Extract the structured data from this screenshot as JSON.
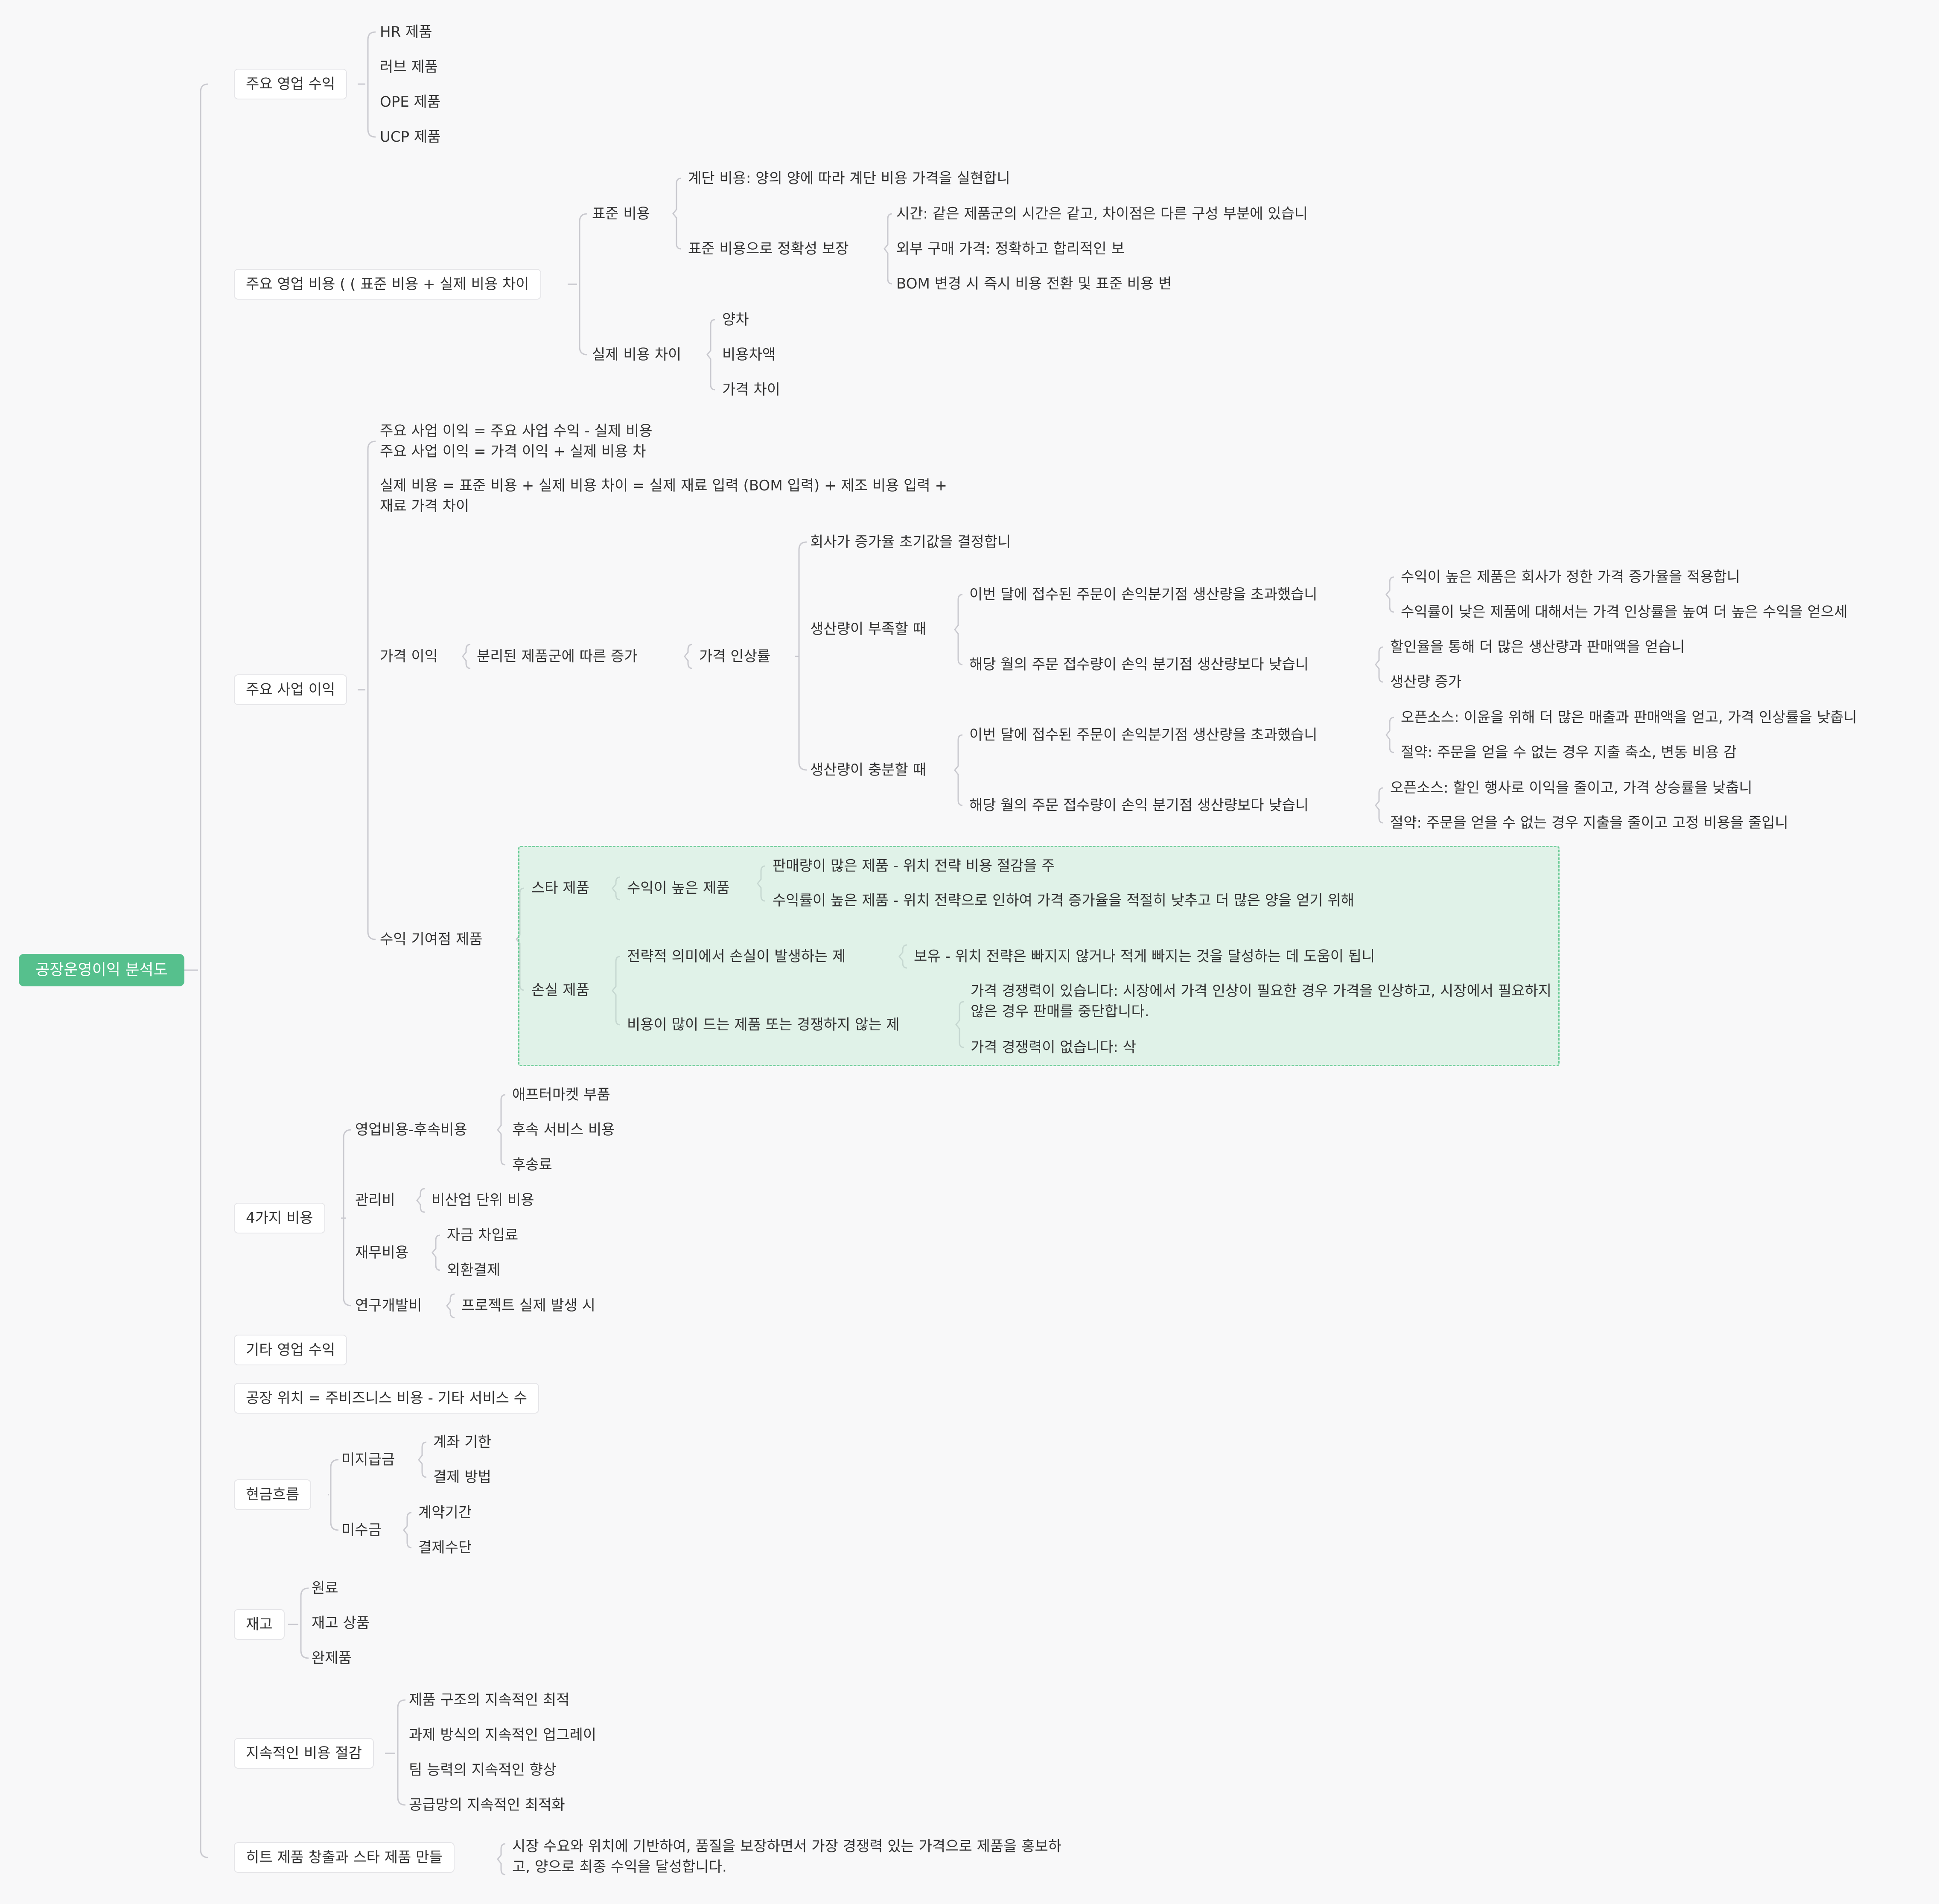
{
  "root": "공장운영이익 분석도",
  "l1": {
    "revenue": "주요 영업 수익",
    "cost": "주요 영업 비용 ( ( 표준 비용 + 실제 비용 차이",
    "profit": "주요 사업 이익",
    "four_costs": "4가지 비용",
    "other_rev": "기타 영업 수익",
    "factory_pos": "공장 위치 = 주비즈니스 비용 - 기타 서비스 수",
    "cashflow": "현금흐름",
    "inventory": "재고",
    "cost_reduction": "지속적인 비용 절감",
    "hit": "히트 제품 창출과 스타 제품 만들"
  },
  "revenue": {
    "items": [
      "HR 제품",
      "러브 제품",
      "OPE 제품",
      "UCP 제품"
    ]
  },
  "cost": {
    "std": "표준 비용",
    "std_step": "계단 비용: 양의 양에 따라 계단 비용 가격을 실현합니",
    "std_ensure": "표준 비용으로 정확성 보장",
    "ensure_items": [
      "시간: 같은 제품군의 시간은 같고, 차이점은 다른 구성 부분에 있습니",
      "외부 구매 가격: 정확하고 합리적인 보",
      "BOM 변경 시 즉시 비용 전환 및 표준 비용 변"
    ],
    "actual": "실제 비용 차이",
    "actual_items": [
      "양차",
      "비용차액",
      "가격 차이"
    ]
  },
  "profit": {
    "formula1": "주요 사업 이익 = 주요 사업 수익 - 실제 비용",
    "formula2": "주요 사업 이익 = 가격 이익 + 실제 비용 차",
    "formula3": "실제 비용 = 표준 비용 + 실제 비용 차이 = 실제 재료 입력 (BOM 입력) + 제조 비용 입력 + 재료 가격 차이",
    "price_profit": "가격 이익",
    "by_group": "분리된 제품군에 따른 증가",
    "rate": "가격 인상률",
    "rate_init": "회사가 증가율 초기값을 결정합니",
    "shortage": "생산량이 부족할 때",
    "short_over": "이번 달에 접수된 주문이 손익분기점 생산량을 초과했습니",
    "short_over_items": [
      "수익이 높은 제품은 회사가 정한 가격 증가율을 적용합니",
      "수익률이 낮은 제품에 대해서는 가격 인상률을 높여 더 높은 수익을 얻으세"
    ],
    "short_under": "해당 월의 주문 접수량이 손익 분기점 생산량보다 낮습니",
    "short_under_items": [
      "할인율을 통해 더 많은 생산량과 판매액을 얻습니",
      "생산량 증가"
    ],
    "enough": "생산량이 충분할 때",
    "enough_over": "이번 달에 접수된 주문이 손익분기점 생산량을 초과했습니",
    "enough_over_items": [
      "오픈소스: 이윤을 위해 더 많은 매출과 판매액을 얻고, 가격 인상률을 낮춥니",
      "절약: 주문을 얻을 수 없는 경우 지출 축소, 변동 비용 감"
    ],
    "enough_under": "해당 월의 주문 접수량이 손익 분기점 생산량보다 낮습니",
    "enough_under_items": [
      "오픈소스: 할인 행사로 이익을 줄이고, 가격 상승률을 낮춥니",
      "절약: 주문을 얻을 수 없는 경우 지출을 줄이고 고정 비용을 줄입니"
    ],
    "contrib": "수익 기여점 제품",
    "star": "스타 제품",
    "high_rev": "수익이 높은 제품",
    "star_items": [
      "판매량이 많은 제품 - 위치 전략 비용 절감을 주",
      "수익률이 높은 제품 - 위치 전략으로 인하여 가격 증가율을 적절히 낮추고 더 많은 양을 얻기 위해"
    ],
    "loss": "손실 제품",
    "strategic": "전략적 의미에서 손실이 발생하는 제",
    "strategic_item": "보유 - 위치 전략은 빠지지 않거나 적게 빠지는 것을 달성하는 데 도움이 됩니",
    "costly": "비용이 많이 드는 제품 또는 경쟁하지 않는 제",
    "costly_items": [
      "가격 경쟁력이 있습니다: 시장에서 가격 인상이 필요한 경우 가격을 인상하고, 시장에서 필요하지 않은 경우 판매를 중단합니다.",
      "가격 경쟁력이 없습니다: 삭"
    ]
  },
  "four": {
    "sales": "영업비용-후속비용",
    "sales_items": [
      "애프터마켓 부품",
      "후속 서비스 비용",
      "후송료"
    ],
    "admin": "관리비",
    "admin_item": "비산업 단위 비용",
    "finance": "재무비용",
    "finance_items": [
      "자금 차입료",
      "외환결제"
    ],
    "rnd": "연구개발비",
    "rnd_item": "프로젝트 실제 발생 시"
  },
  "cash": {
    "payable": "미지급금",
    "payable_items": [
      "계좌 기한",
      "결제 방법"
    ],
    "receivable": "미수금",
    "receivable_items": [
      "계약기간",
      "결제수단"
    ]
  },
  "inventory": {
    "items": [
      "원료",
      "재고 상품",
      "완제품"
    ]
  },
  "reduction": {
    "items": [
      "제품 구조의 지속적인 최적",
      "과제 방식의 지속적인 업그레이",
      "팀 능력의 지속적인 향상",
      "공급망의 지속적인 최적화"
    ]
  },
  "hit": {
    "text": "시장 수요와 위치에 기반하여, 품질을 보장하면서 가장 경쟁력 있는 가격으로 제품을 홍보하고, 양으로 최종 수익을 달성합니다."
  },
  "colors": {
    "root": "#56c08d",
    "line": "#c9c9cf",
    "highlight": "#6ccc97"
  }
}
